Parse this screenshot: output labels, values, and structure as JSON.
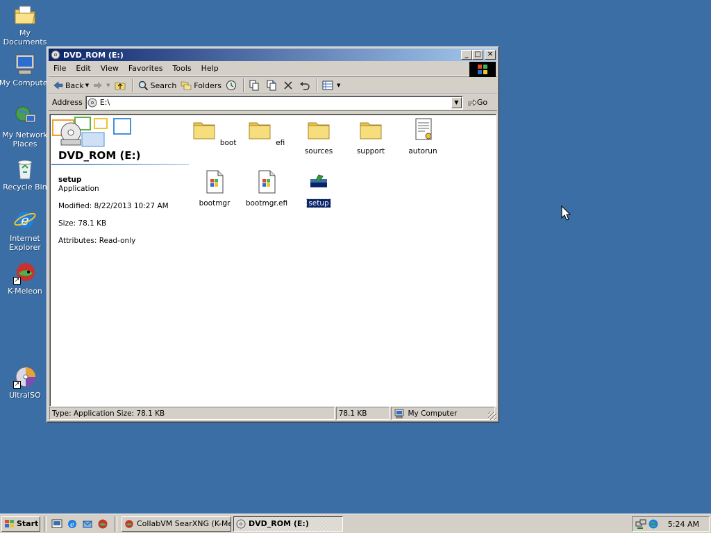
{
  "desktop": {
    "icons": [
      {
        "label": "My Documents"
      },
      {
        "label": "My Computer"
      },
      {
        "label": "My Network Places"
      },
      {
        "label": "Recycle Bin"
      },
      {
        "label": "Internet Explorer"
      },
      {
        "label": "K-Meleon"
      },
      {
        "label": "UltraISO"
      }
    ]
  },
  "window": {
    "title": "DVD_ROM (E:)",
    "menu": [
      "File",
      "Edit",
      "View",
      "Favorites",
      "Tools",
      "Help"
    ],
    "toolbar": {
      "back": "Back",
      "search": "Search",
      "folders": "Folders"
    },
    "address": {
      "label": "Address",
      "value": "E:\\",
      "go": "Go"
    },
    "sidebar": {
      "title": "DVD_ROM (E:)",
      "selected_name": "setup",
      "selected_type": "Application",
      "modified": "Modified: 8/22/2013 10:27 AM",
      "size": "Size: 78.1 KB",
      "attributes": "Attributes: Read-only"
    },
    "files": [
      {
        "name": "boot",
        "kind": "folder"
      },
      {
        "name": "efi",
        "kind": "folder"
      },
      {
        "name": "sources",
        "kind": "folder"
      },
      {
        "name": "support",
        "kind": "folder"
      },
      {
        "name": "autorun",
        "kind": "ini"
      },
      {
        "name": "bootmgr",
        "kind": "system"
      },
      {
        "name": "bootmgr.efi",
        "kind": "system"
      },
      {
        "name": "setup",
        "kind": "application",
        "selected": true
      }
    ],
    "status": {
      "info": "Type: Application Size: 78.1 KB",
      "size": "78.1 KB",
      "zone": "My Computer"
    }
  },
  "taskbar": {
    "start": "Start",
    "tasks": [
      {
        "label": "CollabVM SearXNG (K-Mel..."
      },
      {
        "label": "DVD_ROM (E:)",
        "active": true
      }
    ],
    "clock": "5:24 AM"
  },
  "colors": {
    "desktop": "#3a6ea5",
    "face": "#d4d0c8",
    "title_start": "#0a246a",
    "title_end": "#a6caf0",
    "selection": "#0a246a"
  }
}
